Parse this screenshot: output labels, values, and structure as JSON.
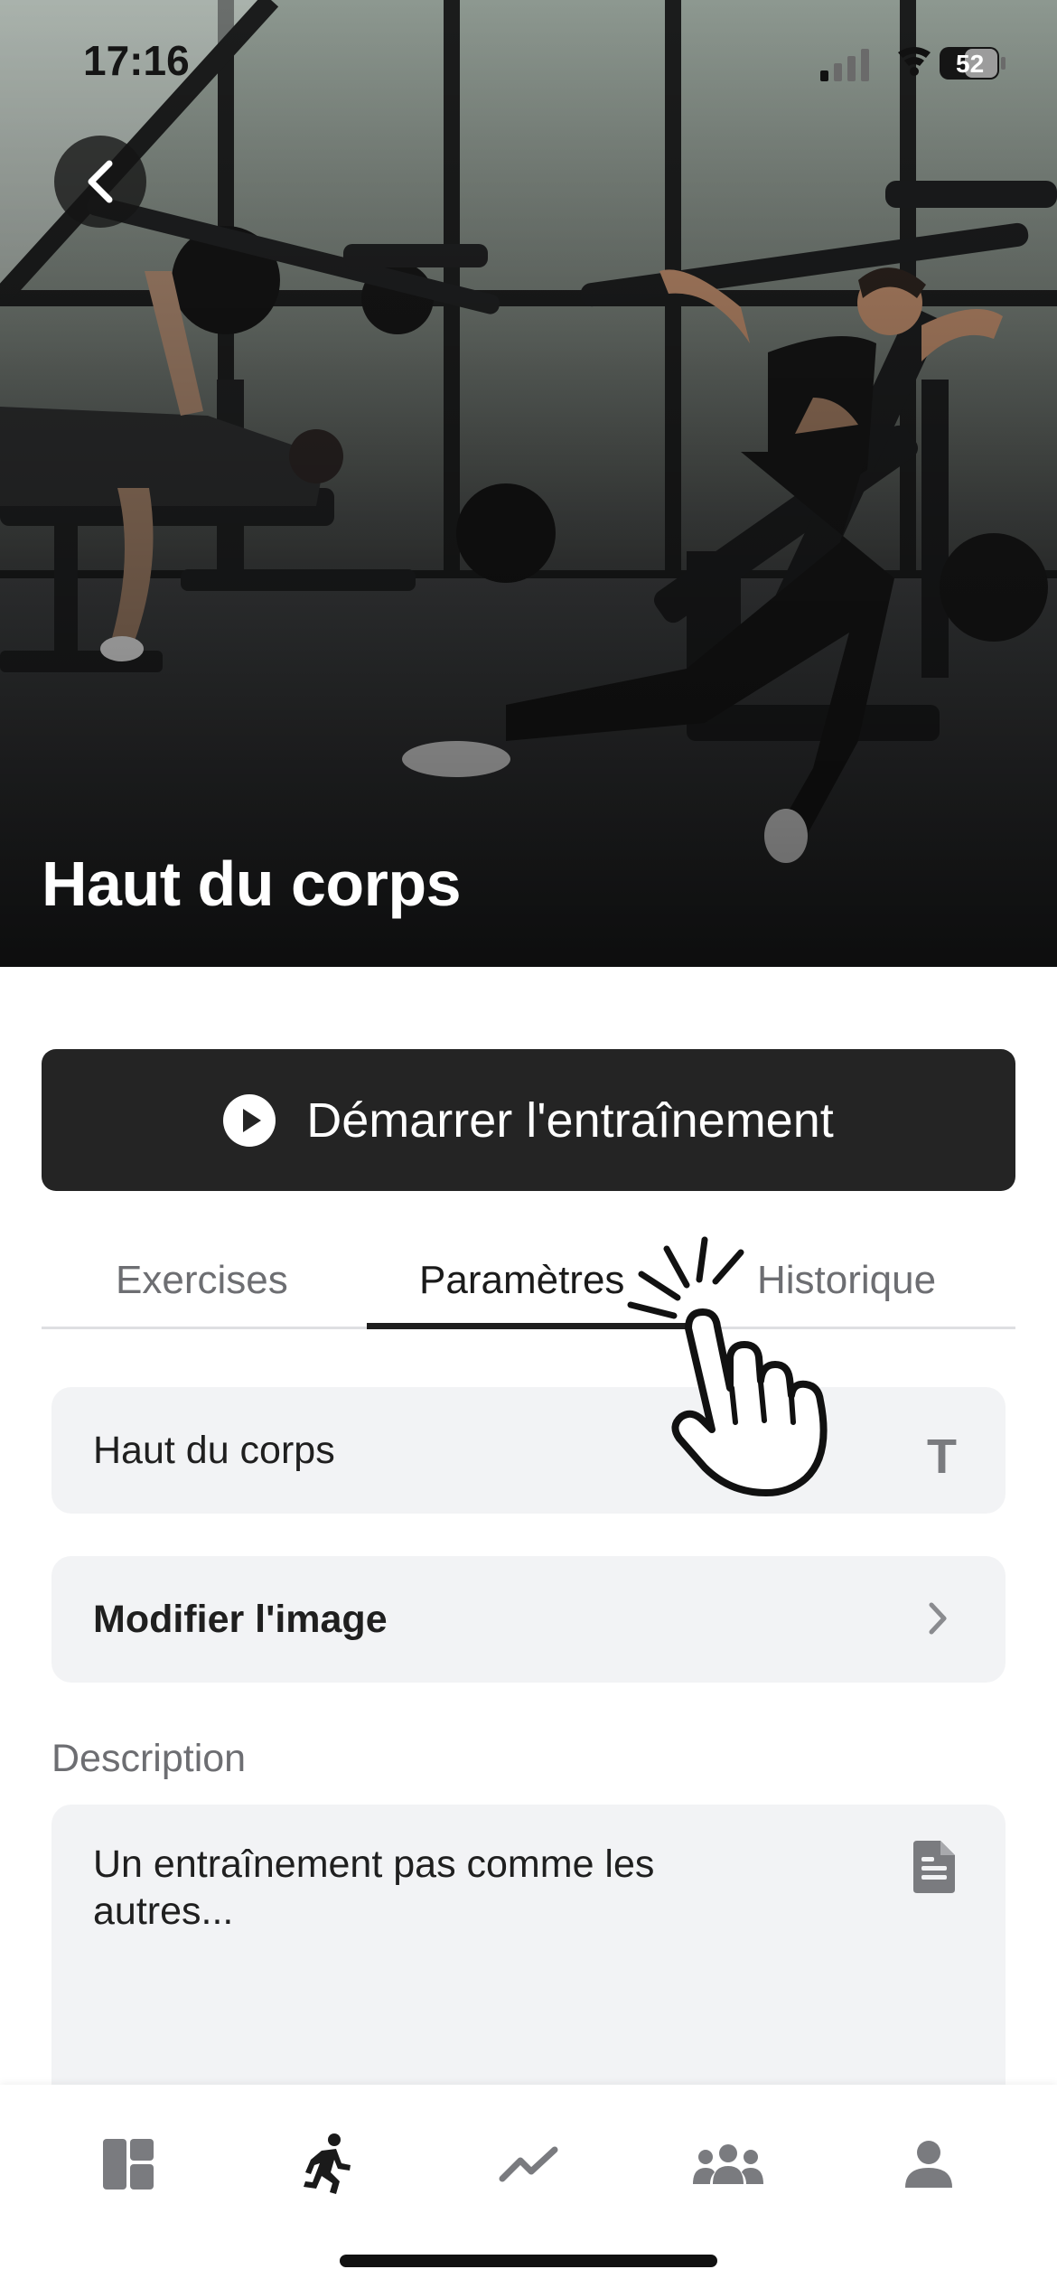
{
  "status_bar": {
    "time": "17:16",
    "battery": "52"
  },
  "hero": {
    "title": "Haut du corps"
  },
  "start_button": {
    "label": "Démarrer l'entraînement"
  },
  "tabs": [
    {
      "label": "Exercises",
      "active": false
    },
    {
      "label": "Paramètres",
      "active": true
    },
    {
      "label": "Historique",
      "active": false
    }
  ],
  "settings": {
    "name_value": "Haut du corps",
    "name_icon": "text-icon",
    "image_label": "Modifier l'image",
    "description_label": "Description",
    "description_value": "Un entraînement pas comme les autres..."
  },
  "tabbar": {
    "items": [
      {
        "icon": "dashboard-icon",
        "active": false
      },
      {
        "icon": "running-icon",
        "active": true
      },
      {
        "icon": "chart-line-icon",
        "active": false
      },
      {
        "icon": "group-icon",
        "active": false
      },
      {
        "icon": "profile-icon",
        "active": false
      }
    ]
  },
  "colors": {
    "button_bg": "#242424",
    "field_bg": "#f2f3f5",
    "inactive_icon": "#7a7b7f",
    "active_icon": "#1a1a1a"
  }
}
